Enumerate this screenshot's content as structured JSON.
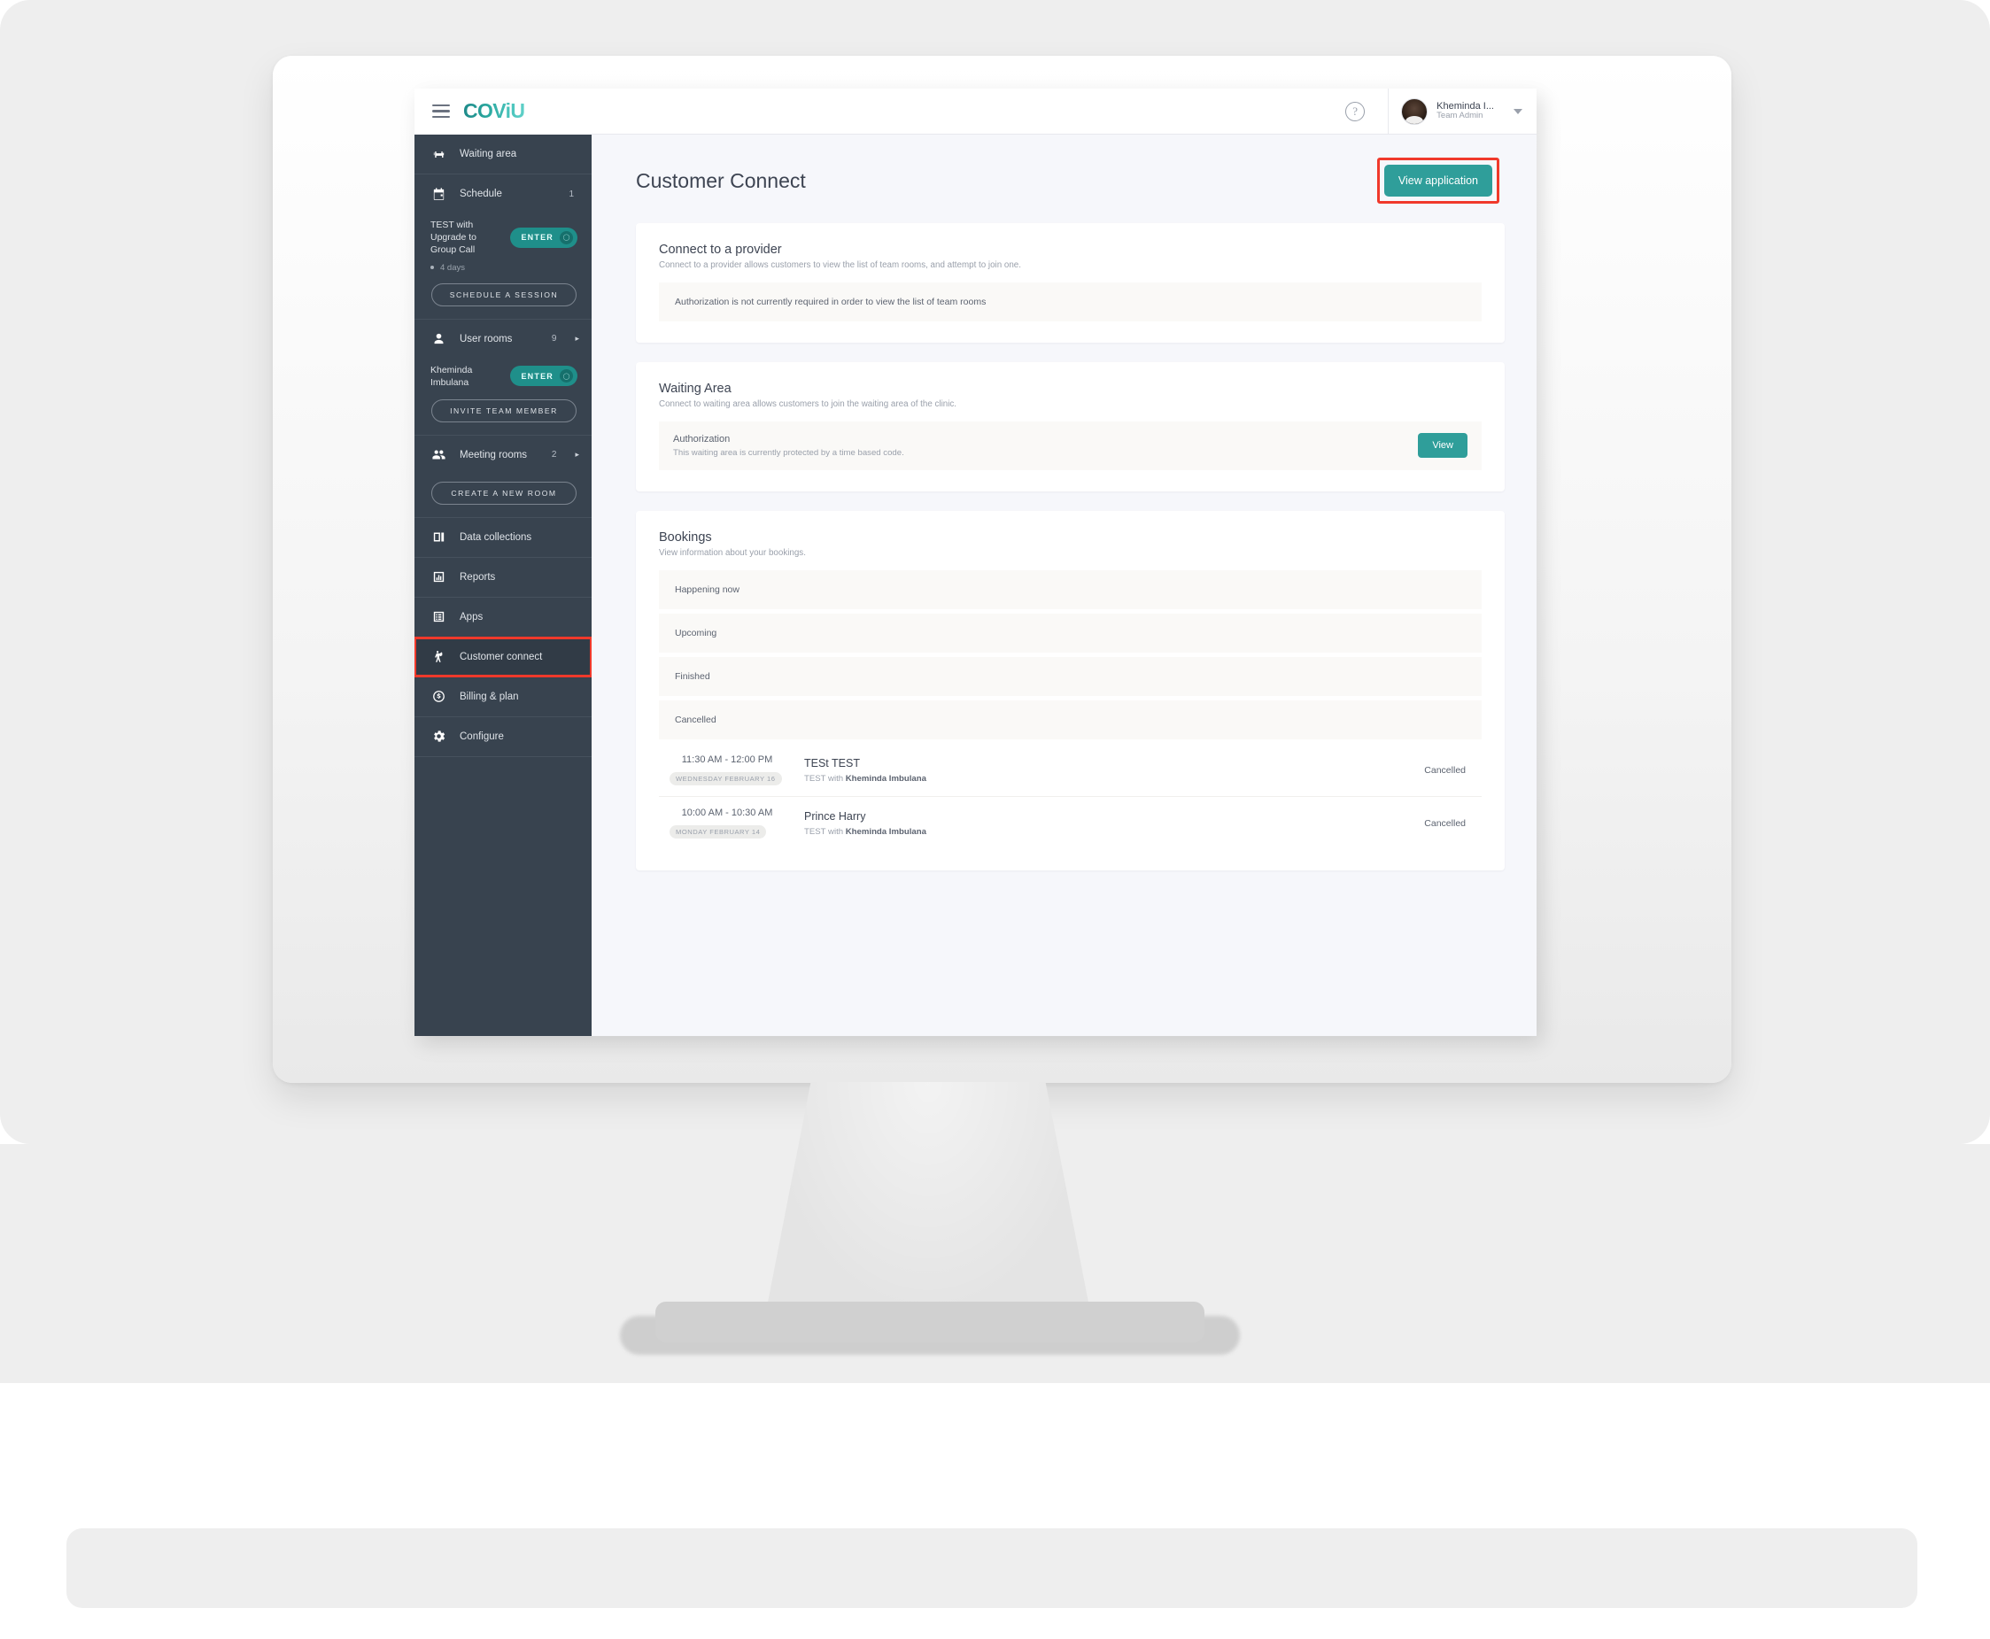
{
  "colors": {
    "accent": "#2f9e9a",
    "sidebar_bg": "#38434f",
    "highlight": "#f0392b",
    "page_bg": "#f6f7fb"
  },
  "topbar": {
    "logo": "COViU",
    "menu_label": "menu",
    "help_label": "?",
    "user_name": "Kheminda I...",
    "user_role": "Team Admin"
  },
  "sidebar": {
    "items": [
      {
        "label": "Waiting area",
        "icon": "waiting-area-icon",
        "count": "",
        "arrow": ""
      },
      {
        "label": "Schedule",
        "icon": "calendar-icon",
        "count": "1",
        "arrow": ""
      },
      {
        "label": "User rooms",
        "icon": "user-icon",
        "count": "9",
        "arrow": "▸"
      },
      {
        "label": "Meeting rooms",
        "icon": "group-icon",
        "count": "2",
        "arrow": "▸"
      },
      {
        "label": "Data collections",
        "icon": "collections-icon",
        "count": "",
        "arrow": ""
      },
      {
        "label": "Reports",
        "icon": "chart-icon",
        "count": "",
        "arrow": ""
      },
      {
        "label": "Apps",
        "icon": "apps-icon",
        "count": "",
        "arrow": ""
      },
      {
        "label": "Customer connect",
        "icon": "customer-connect-icon",
        "count": "",
        "arrow": ""
      },
      {
        "label": "Billing & plan",
        "icon": "dollar-icon",
        "count": "",
        "arrow": ""
      },
      {
        "label": "Configure",
        "icon": "gear-icon",
        "count": "",
        "arrow": ""
      }
    ],
    "schedule_room": {
      "name": "TEST with Upgrade to Group Call",
      "enter_label": "ENTER",
      "days": "4 days"
    },
    "schedule_button": "SCHEDULE A SESSION",
    "user_room": {
      "name": "Kheminda Imbulana",
      "enter_label": "ENTER"
    },
    "invite_button": "INVITE TEAM MEMBER",
    "create_room_button": "CREATE A NEW ROOM"
  },
  "main": {
    "page_title": "Customer Connect",
    "view_application_button": "View application",
    "provider_card": {
      "title": "Connect to a provider",
      "subtitle": "Connect to a provider allows customers to view the list of team rooms, and attempt to join one.",
      "info": "Authorization is not currently required in order to view the list of team rooms"
    },
    "waiting_area_card": {
      "title": "Waiting Area",
      "subtitle": "Connect to waiting area allows customers to join the waiting area of the clinic.",
      "auth_title": "Authorization",
      "auth_desc": "This waiting area is currently protected by a time based code.",
      "view_button": "View"
    },
    "bookings_card": {
      "title": "Bookings",
      "subtitle": "View information about your bookings.",
      "groups": [
        "Happening now",
        "Upcoming",
        "Finished",
        "Cancelled"
      ],
      "rows": [
        {
          "time": "11:30 AM - 12:00 PM",
          "date": "WEDNESDAY FEBRUARY 16",
          "name": "TESt TEST",
          "with_prefix": "TEST with ",
          "with_person": "Kheminda Imbulana",
          "status": "Cancelled"
        },
        {
          "time": "10:00 AM - 10:30 AM",
          "date": "MONDAY FEBRUARY 14",
          "name": "Prince Harry",
          "with_prefix": "TEST with ",
          "with_person": "Kheminda Imbulana",
          "status": "Cancelled"
        }
      ]
    }
  }
}
